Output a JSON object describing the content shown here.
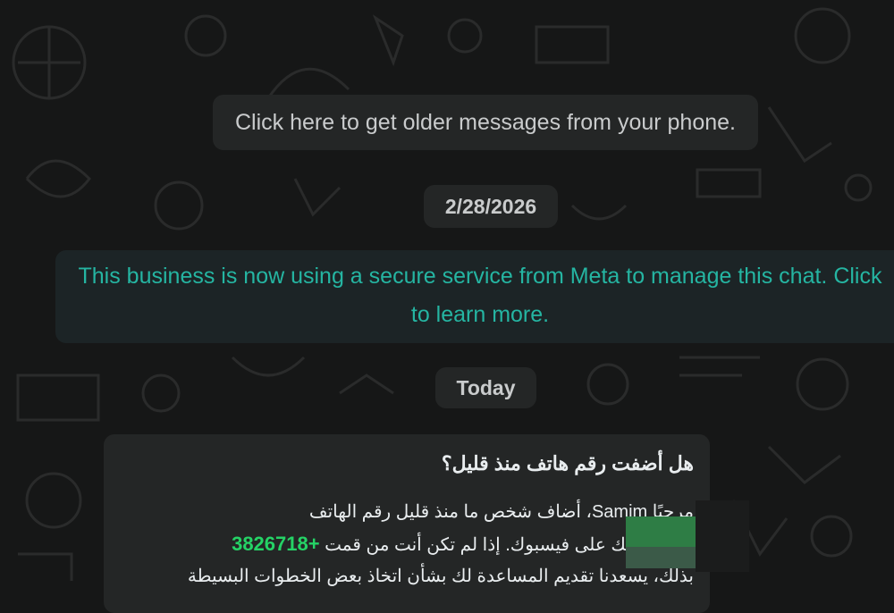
{
  "older_messages": "Click here to get older messages from your phone.",
  "date_separator": "2/28/2026",
  "business_notice": {
    "line1": "This business is now using a secure service from Meta to manage this chat. Click",
    "line2": "to learn more."
  },
  "today_separator": "Today",
  "message": {
    "question": "هل أضفت رقم هاتف منذ قليل؟",
    "line1": "مرحبًا Samim، أضاف شخص ما منذ قليل رقم الهاتف",
    "phone": "+3826718",
    "line2_rest": "إلى حسابك على فيسبوك. إذا لم تكن أنت من قمت",
    "line3": "بذلك، يسعدنا تقديم المساعدة لك بشأن اتخاذ بعض الخطوات البسيطة"
  },
  "colors": {
    "background": "#161717",
    "bubble": "#242626",
    "notice_text": "#25b5a2",
    "phone_link": "#25d366"
  }
}
